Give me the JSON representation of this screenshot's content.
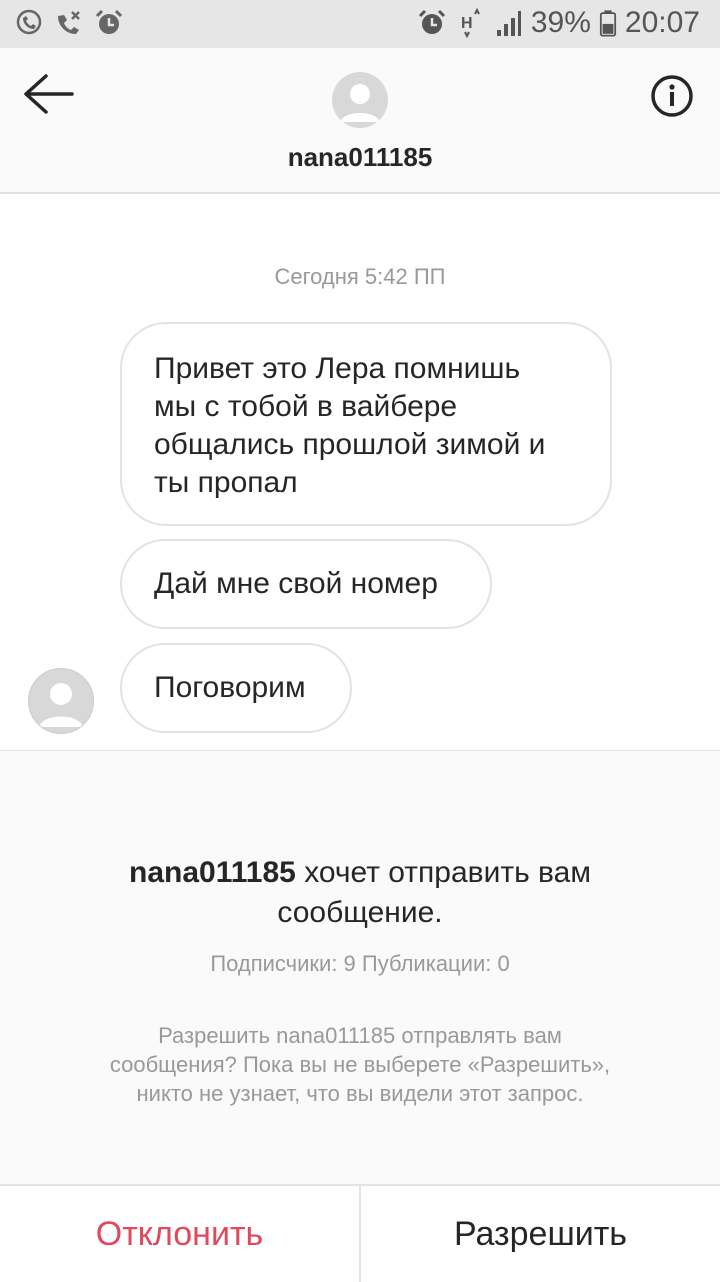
{
  "status_bar": {
    "left_icons": [
      "viber-icon",
      "missed-call-icon",
      "alarm-icon"
    ],
    "right_icons": [
      "alarm-icon",
      "network-h-icon",
      "signal-icon",
      "battery-icon"
    ],
    "battery": "39%",
    "time": "20:07"
  },
  "header": {
    "username": "nana011185",
    "icons": [
      "back-arrow-icon",
      "profile-avatar-icon",
      "info-icon"
    ]
  },
  "chat": {
    "timestamp": "Сегодня 5:42 ПП",
    "messages": [
      {
        "lines": [
          "Привет это Лера помнишь",
          "мы с тобой в вайбере",
          "общались прошлой зимой и",
          "ты пропал"
        ]
      },
      {
        "lines": [
          "Дай мне свой номер"
        ]
      },
      {
        "lines": [
          "Поговорим"
        ]
      }
    ]
  },
  "request": {
    "username": "nana011185",
    "title_rest": " хочет отправить вам",
    "title_line2": "сообщение.",
    "stats": "Подписчики: 9 Публикации: 0",
    "desc_lines": [
      "Разрешить nana011185 отправлять вам",
      "сообщения? Пока вы не выберете «Разрешить»,",
      "никто не узнает, что вы видели этот запрос."
    ]
  },
  "actions": {
    "decline_label": "Отклонить",
    "accept_label": "Разрешить"
  },
  "colors": {
    "decline": "#e0495b",
    "muted_text": "#999999",
    "text": "#262626",
    "statusbar_bg": "#e6e6e6"
  }
}
